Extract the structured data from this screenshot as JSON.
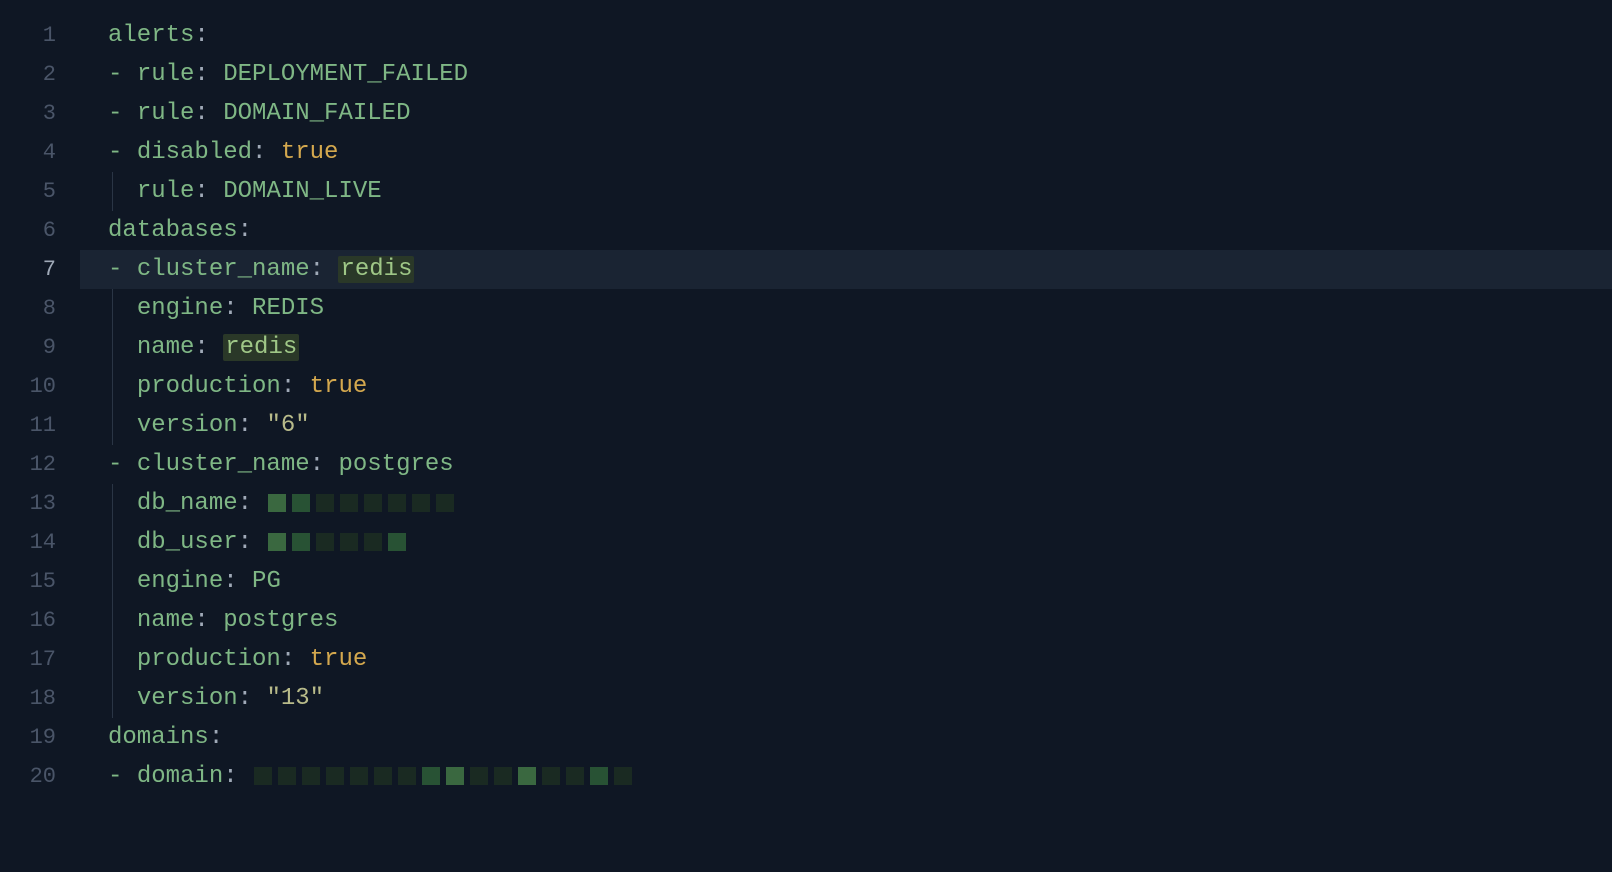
{
  "editor": {
    "active_line": 7,
    "lines": [
      {
        "n": 1,
        "indent": 0,
        "guide": false,
        "segments": [
          {
            "t": "key",
            "v": "alerts"
          },
          {
            "t": "colon",
            "v": ":"
          }
        ]
      },
      {
        "n": 2,
        "indent": 0,
        "guide": false,
        "segments": [
          {
            "t": "dash",
            "v": "- "
          },
          {
            "t": "key",
            "v": "rule"
          },
          {
            "t": "colon",
            "v": ": "
          },
          {
            "t": "value",
            "v": "DEPLOYMENT_FAILED"
          }
        ]
      },
      {
        "n": 3,
        "indent": 0,
        "guide": false,
        "segments": [
          {
            "t": "dash",
            "v": "- "
          },
          {
            "t": "key",
            "v": "rule"
          },
          {
            "t": "colon",
            "v": ": "
          },
          {
            "t": "value",
            "v": "DOMAIN_FAILED"
          }
        ]
      },
      {
        "n": 4,
        "indent": 0,
        "guide": false,
        "segments": [
          {
            "t": "dash",
            "v": "- "
          },
          {
            "t": "key",
            "v": "disabled"
          },
          {
            "t": "colon",
            "v": ": "
          },
          {
            "t": "bool",
            "v": "true"
          }
        ]
      },
      {
        "n": 5,
        "indent": 1,
        "guide": true,
        "segments": [
          {
            "t": "key",
            "v": "rule"
          },
          {
            "t": "colon",
            "v": ": "
          },
          {
            "t": "value",
            "v": "DOMAIN_LIVE"
          }
        ]
      },
      {
        "n": 6,
        "indent": 0,
        "guide": false,
        "segments": [
          {
            "t": "key",
            "v": "databases"
          },
          {
            "t": "colon",
            "v": ":"
          }
        ]
      },
      {
        "n": 7,
        "indent": 0,
        "guide": false,
        "highlight": true,
        "segments": [
          {
            "t": "dash",
            "v": "- "
          },
          {
            "t": "key",
            "v": "cluster_name"
          },
          {
            "t": "colon",
            "v": ": "
          },
          {
            "t": "match",
            "v": "redis"
          }
        ]
      },
      {
        "n": 8,
        "indent": 1,
        "guide": true,
        "segments": [
          {
            "t": "key",
            "v": "engine"
          },
          {
            "t": "colon",
            "v": ": "
          },
          {
            "t": "value",
            "v": "REDIS"
          }
        ]
      },
      {
        "n": 9,
        "indent": 1,
        "guide": true,
        "segments": [
          {
            "t": "key",
            "v": "name"
          },
          {
            "t": "colon",
            "v": ": "
          },
          {
            "t": "match",
            "v": "redis"
          }
        ]
      },
      {
        "n": 10,
        "indent": 1,
        "guide": true,
        "segments": [
          {
            "t": "key",
            "v": "production"
          },
          {
            "t": "colon",
            "v": ": "
          },
          {
            "t": "bool",
            "v": "true"
          }
        ]
      },
      {
        "n": 11,
        "indent": 1,
        "guide": true,
        "segments": [
          {
            "t": "key",
            "v": "version"
          },
          {
            "t": "colon",
            "v": ": "
          },
          {
            "t": "string",
            "v": "\"6\""
          }
        ]
      },
      {
        "n": 12,
        "indent": 0,
        "guide": false,
        "segments": [
          {
            "t": "dash",
            "v": "- "
          },
          {
            "t": "key",
            "v": "cluster_name"
          },
          {
            "t": "colon",
            "v": ": "
          },
          {
            "t": "value",
            "v": "postgres"
          }
        ]
      },
      {
        "n": 13,
        "indent": 1,
        "guide": true,
        "segments": [
          {
            "t": "key",
            "v": "db_name"
          },
          {
            "t": "colon",
            "v": ": "
          },
          {
            "t": "redact",
            "pattern": [
              "light",
              "mid",
              "dark",
              "dark",
              "dark",
              "dark",
              "dark",
              "dark"
            ]
          }
        ]
      },
      {
        "n": 14,
        "indent": 1,
        "guide": true,
        "segments": [
          {
            "t": "key",
            "v": "db_user"
          },
          {
            "t": "colon",
            "v": ": "
          },
          {
            "t": "redact",
            "pattern": [
              "light",
              "mid",
              "dark",
              "dark",
              "dark",
              "mid"
            ]
          }
        ]
      },
      {
        "n": 15,
        "indent": 1,
        "guide": true,
        "segments": [
          {
            "t": "key",
            "v": "engine"
          },
          {
            "t": "colon",
            "v": ": "
          },
          {
            "t": "value",
            "v": "PG"
          }
        ]
      },
      {
        "n": 16,
        "indent": 1,
        "guide": true,
        "segments": [
          {
            "t": "key",
            "v": "name"
          },
          {
            "t": "colon",
            "v": ": "
          },
          {
            "t": "value",
            "v": "postgres"
          }
        ]
      },
      {
        "n": 17,
        "indent": 1,
        "guide": true,
        "segments": [
          {
            "t": "key",
            "v": "production"
          },
          {
            "t": "colon",
            "v": ": "
          },
          {
            "t": "bool",
            "v": "true"
          }
        ]
      },
      {
        "n": 18,
        "indent": 1,
        "guide": true,
        "segments": [
          {
            "t": "key",
            "v": "version"
          },
          {
            "t": "colon",
            "v": ": "
          },
          {
            "t": "string",
            "v": "\"13\""
          }
        ]
      },
      {
        "n": 19,
        "indent": 0,
        "guide": false,
        "segments": [
          {
            "t": "key",
            "v": "domains"
          },
          {
            "t": "colon",
            "v": ":"
          }
        ]
      },
      {
        "n": 20,
        "indent": 0,
        "guide": false,
        "segments": [
          {
            "t": "dash",
            "v": "- "
          },
          {
            "t": "key",
            "v": "domain"
          },
          {
            "t": "colon",
            "v": ": "
          },
          {
            "t": "redact",
            "pattern": [
              "dark",
              "dark",
              "dark",
              "dark",
              "dark",
              "dark",
              "dark",
              "mid",
              "light",
              "dark",
              "dark",
              "light",
              "dark",
              "dark",
              "mid",
              "dark"
            ]
          }
        ]
      }
    ]
  }
}
